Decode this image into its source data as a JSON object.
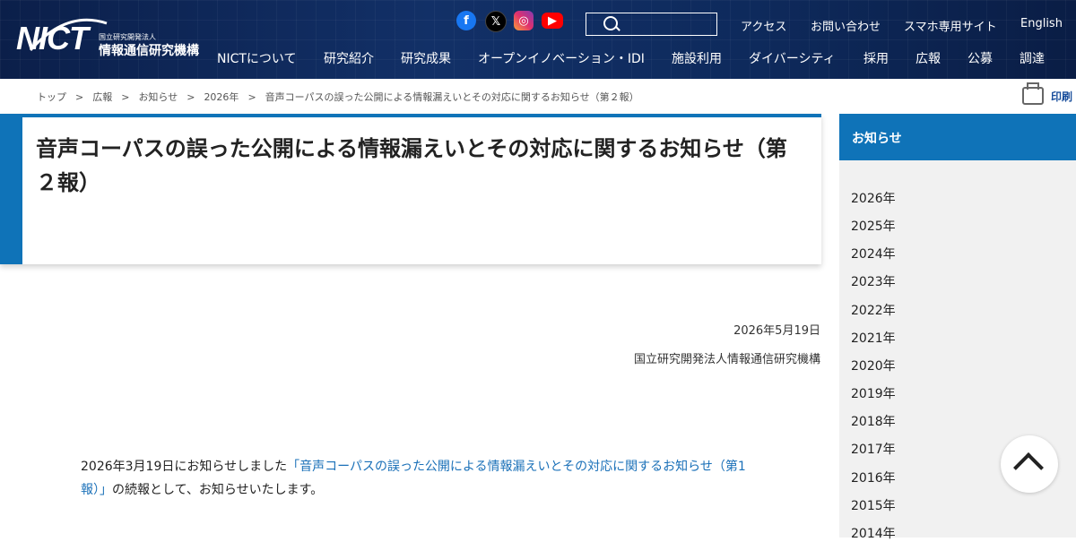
{
  "header": {
    "logo_mark": "NICT",
    "logo_sub": "国立研究開発法人",
    "logo_name": "情報通信研究機構",
    "social": [
      "f",
      "𝕏",
      "◎",
      "▶"
    ],
    "util_links": [
      "アクセス",
      "お問い合わせ",
      "スマホ専用サイト",
      "English"
    ],
    "nav": [
      "NICTについて",
      "研究紹介",
      "研究成果",
      "オープンイノベーション・IDI",
      "施設利用",
      "ダイバーシティ",
      "採用",
      "広報",
      "公募",
      "調達"
    ]
  },
  "breadcrumb": [
    "トップ",
    "広報",
    "お知らせ",
    "2026年",
    "音声コーパスの誤った公開による情報漏えいとその対応に関するお知らせ（第２報）"
  ],
  "print_label": "印刷",
  "article": {
    "title": "音声コーパスの誤った公開による情報漏えいとその対応に関するお知らせ（第２報）",
    "date": "2026年5月19日",
    "org": "国立研究開発法人情報通信研究機構",
    "body_prefix": "2026年3月19日にお知らせしました",
    "body_link": "「音声コーパスの誤った公開による情報漏えいとその対応に関するお知らせ（第1報）」",
    "body_suffix": "の続報として、お知らせいたします。"
  },
  "sidebar": {
    "heading": "お知らせ",
    "years": [
      "2026年",
      "2025年",
      "2024年",
      "2023年",
      "2022年",
      "2021年",
      "2020年",
      "2019年",
      "2018年",
      "2017年",
      "2016年",
      "2015年",
      "2014年"
    ]
  }
}
